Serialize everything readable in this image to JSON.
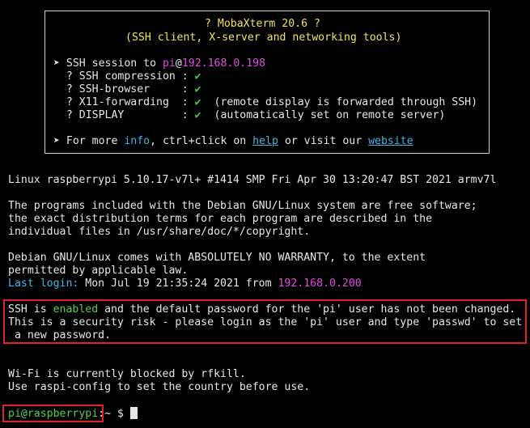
{
  "banner": {
    "title": "? MobaXterm 20.6 ?",
    "subtitle": "(SSH client, X-server and networking tools)",
    "session_prefix": "➤ SSH session to ",
    "session_user": "pi",
    "session_at": "@",
    "session_host": "192.168.0.198",
    "rows": [
      {
        "label": "  ? SSH compression : ",
        "check": "✔",
        "note": ""
      },
      {
        "label": "  ? SSH-browser     : ",
        "check": "✔",
        "note": ""
      },
      {
        "label": "  ? X11-forwarding  : ",
        "check": "✔",
        "note": "  (remote display is forwarded through SSH)"
      },
      {
        "label": "  ? DISPLAY         : ",
        "check": "✔",
        "note": "  (automatically set on remote server)"
      }
    ],
    "more_prefix": "➤ For more ",
    "more_info": "info",
    "more_mid": ", ctrl+click on ",
    "more_help": "help",
    "more_mid2": " or visit our ",
    "more_website": "website"
  },
  "system": {
    "uname": "Linux raspberrypi 5.10.17-v7l+ #1414 SMP Fri Apr 30 13:20:47 BST 2021 armv7l",
    "programs_1": "The programs included with the Debian GNU/Linux system are free software;",
    "programs_2": "the exact distribution terms for each program are described in the",
    "programs_3": "individual files in /usr/share/doc/*/copyright.",
    "warranty_1": "Debian GNU/Linux comes with ABSOLUTELY NO WARRANTY, to the extent",
    "warranty_2": "permitted by applicable law.",
    "last_login_label": "Last login:",
    "last_login_value": " Mon Jul 19 21:35:24 2021 from ",
    "last_login_ip": "192.168.0.200"
  },
  "warning": {
    "line1_prefix": "SSH is ",
    "line1_enabled": "enabled",
    "line1_suffix": " and the default password for the 'pi' user has not been changed.",
    "line2": "This is a security risk - please login as the 'pi' user and type 'passwd' to set",
    "line3": " a new password."
  },
  "wifi": {
    "line1": "Wi-Fi is currently blocked by rfkill.",
    "line2": "Use raspi-config to set the country before use."
  },
  "prompt": {
    "user_host": "pi@raspberrypi",
    "path": ":~ $ "
  },
  "colors": {
    "background": "#000000",
    "text": "#e6e6e6",
    "yellow": "#f3e25c",
    "magenta": "#e04ae0",
    "cyan": "#3fb6e6",
    "green": "#4fcf4f",
    "highlight_red": "#e02424"
  }
}
